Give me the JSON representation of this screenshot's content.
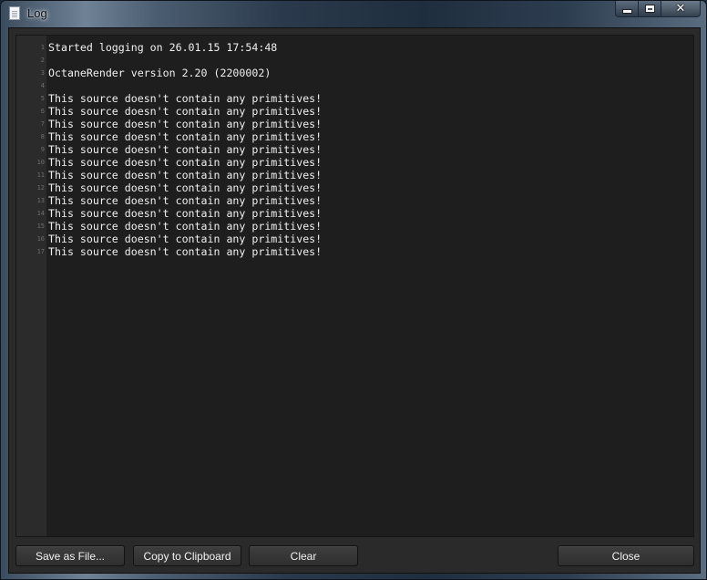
{
  "window": {
    "title": "Log",
    "controls": {
      "minimize": "minimize",
      "maximize": "maximize",
      "close": "✕"
    }
  },
  "log": {
    "line_numbers": [
      "1",
      "2",
      "3",
      "4",
      "5",
      "6",
      "7",
      "8",
      "9",
      "10",
      "11",
      "12",
      "13",
      "14",
      "15",
      "16",
      "17"
    ],
    "lines": [
      "Started logging on 26.01.15 17:54:48",
      "",
      "OctaneRender version 2.20 (2200002)",
      "",
      "This source doesn't contain any primitives!",
      "This source doesn't contain any primitives!",
      "This source doesn't contain any primitives!",
      "This source doesn't contain any primitives!",
      "This source doesn't contain any primitives!",
      "This source doesn't contain any primitives!",
      "This source doesn't contain any primitives!",
      "This source doesn't contain any primitives!",
      "This source doesn't contain any primitives!",
      "This source doesn't contain any primitives!",
      "This source doesn't contain any primitives!",
      "This source doesn't contain any primitives!",
      "This source doesn't contain any primitives!"
    ]
  },
  "buttons": {
    "save_as_file": "Save as File...",
    "copy_to_clipboard": "Copy to Clipboard",
    "clear": "Clear",
    "close": "Close"
  },
  "icons": {
    "window_icon": "document-icon"
  },
  "colors": {
    "editor_background": "#1e1e1e",
    "gutter_background": "#2b2b2b",
    "text": "#f0f0f0",
    "panel_background": "#2a2a2a"
  }
}
